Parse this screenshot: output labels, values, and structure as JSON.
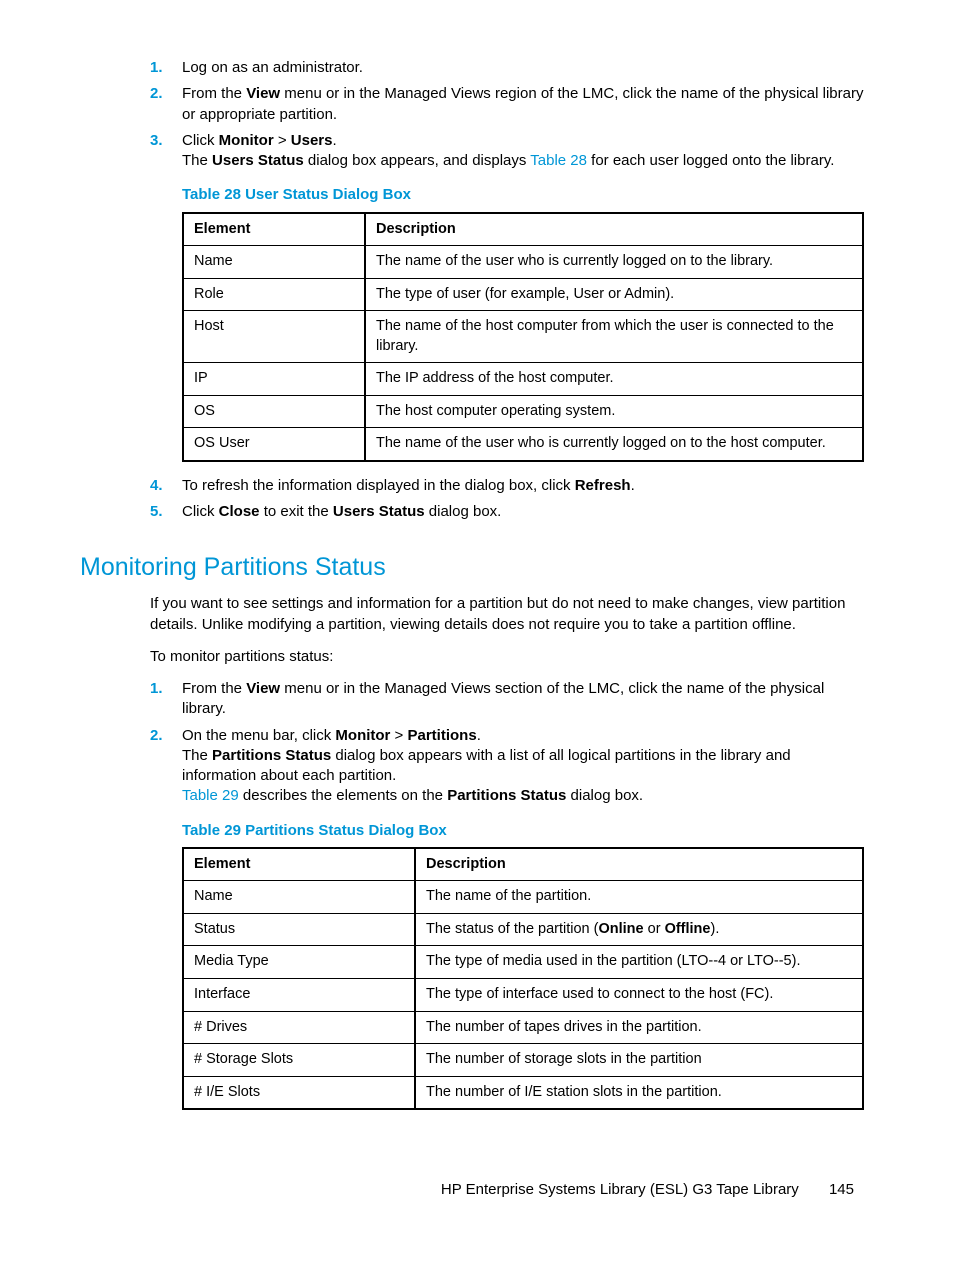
{
  "steps_a": [
    {
      "n": "1.",
      "html": "Log on as an administrator."
    },
    {
      "n": "2.",
      "html": "From the <b>View</b> menu or in the Managed Views region of the LMC, click the name of the physical library or appropriate partition."
    },
    {
      "n": "3.",
      "html": "Click <b>Monitor</b> > <b>Users</b>.<br>The <b>Users Status</b> dialog box appears, and displays <span class=\"link\">Table 28</span> for each user logged onto the library."
    }
  ],
  "table28": {
    "caption": "Table 28 User Status Dialog Box",
    "head": [
      "Element",
      "Description"
    ],
    "rows": [
      [
        "Name",
        "The name of the user who is currently logged on to the library."
      ],
      [
        "Role",
        "The type of user (for example, User or Admin)."
      ],
      [
        "Host",
        "The name of the host computer from which the user is connected to the library."
      ],
      [
        "IP",
        "The IP address of the host computer."
      ],
      [
        "OS",
        "The host computer operating system."
      ],
      [
        "OS User",
        "The name of the user who is currently logged on to the host computer."
      ]
    ]
  },
  "steps_b": [
    {
      "n": "4.",
      "html": "To refresh the information displayed in the dialog box, click <b>Refresh</b>."
    },
    {
      "n": "5.",
      "html": "Click <b>Close</b> to exit the <b>Users Status</b> dialog box."
    }
  ],
  "section_heading": "Monitoring Partitions Status",
  "para1": "If you want to see settings and information for a partition but do not need to make changes, view partition details. Unlike modifying a partition, viewing details does not require you to take a partition offline.",
  "para2": "To monitor partitions status:",
  "steps_c": [
    {
      "n": "1.",
      "html": "From the <b>View</b> menu or in the Managed Views section of the LMC, click the name of the physical library."
    },
    {
      "n": "2.",
      "html": "On the menu bar, click <b>Monitor</b> > <b>Partitions</b>.<br>The <b>Partitions Status</b> dialog box appears with a list of all logical partitions in the library and information about each partition.<br><span class=\"link\">Table 29</span> describes the elements on the <b>Partitions Status</b> dialog box."
    }
  ],
  "table29": {
    "caption": "Table 29 Partitions Status Dialog Box",
    "head": [
      "Element",
      "Description"
    ],
    "rows": [
      [
        "Name",
        "The name of the partition."
      ],
      [
        "Status",
        "The status of the partition (<b>Online</b> or <b>Offline</b>)."
      ],
      [
        "Media Type",
        "The type of media used in the partition (LTO--4 or LTO--5)."
      ],
      [
        "Interface",
        "The type of interface used to connect to the host (FC)."
      ],
      [
        "# Drives",
        "The number of tapes drives in the partition."
      ],
      [
        "# Storage Slots",
        "The number of storage slots in the partition"
      ],
      [
        "# I/E Slots",
        "The number of I/E station slots in the partition."
      ]
    ]
  },
  "footer_text": "HP Enterprise Systems Library (ESL) G3 Tape Library",
  "footer_page": "145"
}
